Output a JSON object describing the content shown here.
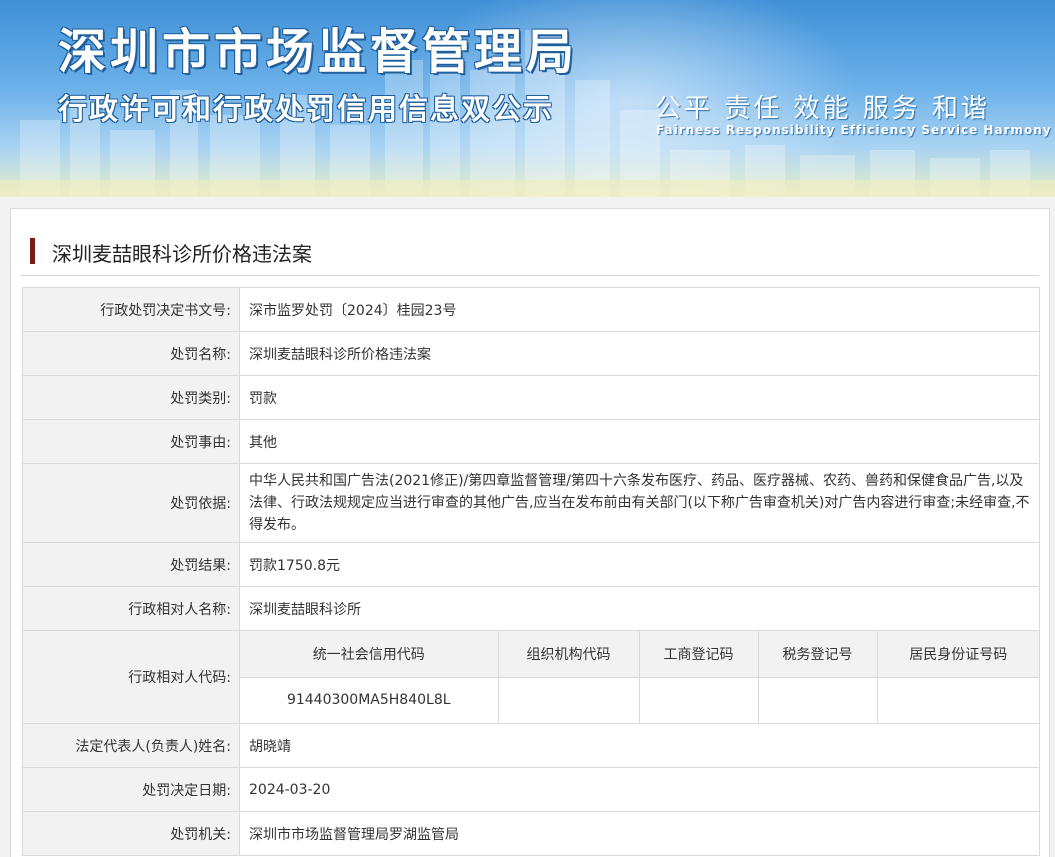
{
  "banner": {
    "title": "深圳市市场监督管理局",
    "subtitle": "行政许可和行政处罚信用信息双公示",
    "slogan_cn": "公平 责任 效能 服务 和谐",
    "slogan_en": "Fairness Responsibility Efficiency Service Harmony"
  },
  "page": {
    "heading": "深圳麦喆眼科诊所价格违法案"
  },
  "fields": {
    "decision_no": {
      "label": "行政处罚决定书文号:",
      "value": "深市监罗处罚〔2024〕桂园23号"
    },
    "case_name": {
      "label": "处罚名称:",
      "value": "深圳麦喆眼科诊所价格违法案"
    },
    "category": {
      "label": "处罚类别:",
      "value": "罚款"
    },
    "reason": {
      "label": "处罚事由:",
      "value": "其他"
    },
    "basis": {
      "label": "处罚依据:",
      "value": "中华人民共和国广告法(2021修正)/第四章监督管理/第四十六条发布医疗、药品、医疗器械、农药、兽药和保健食品广告,以及法律、行政法规规定应当进行审查的其他广告,应当在发布前由有关部门(以下称广告审查机关)对广告内容进行审查;未经审查,不得发布。"
    },
    "result": {
      "label": "处罚结果:",
      "value": "罚款1750.8元"
    },
    "party_name": {
      "label": "行政相对人名称:",
      "value": "深圳麦喆眼科诊所"
    },
    "party_code": {
      "label": "行政相对人代码:",
      "headers": [
        "统一社会信用代码",
        "组织机构代码",
        "工商登记码",
        "税务登记号",
        "居民身份证号码"
      ],
      "values": [
        "91440300MA5H840L8L",
        "",
        "",
        "",
        ""
      ]
    },
    "legal_rep": {
      "label": "法定代表人(负责人)姓名:",
      "value": "胡晓靖"
    },
    "decision_date": {
      "label": "处罚决定日期:",
      "value": "2024-03-20"
    },
    "authority": {
      "label": "处罚机关:",
      "value": "深圳市市场监督管理局罗湖监管局"
    }
  }
}
